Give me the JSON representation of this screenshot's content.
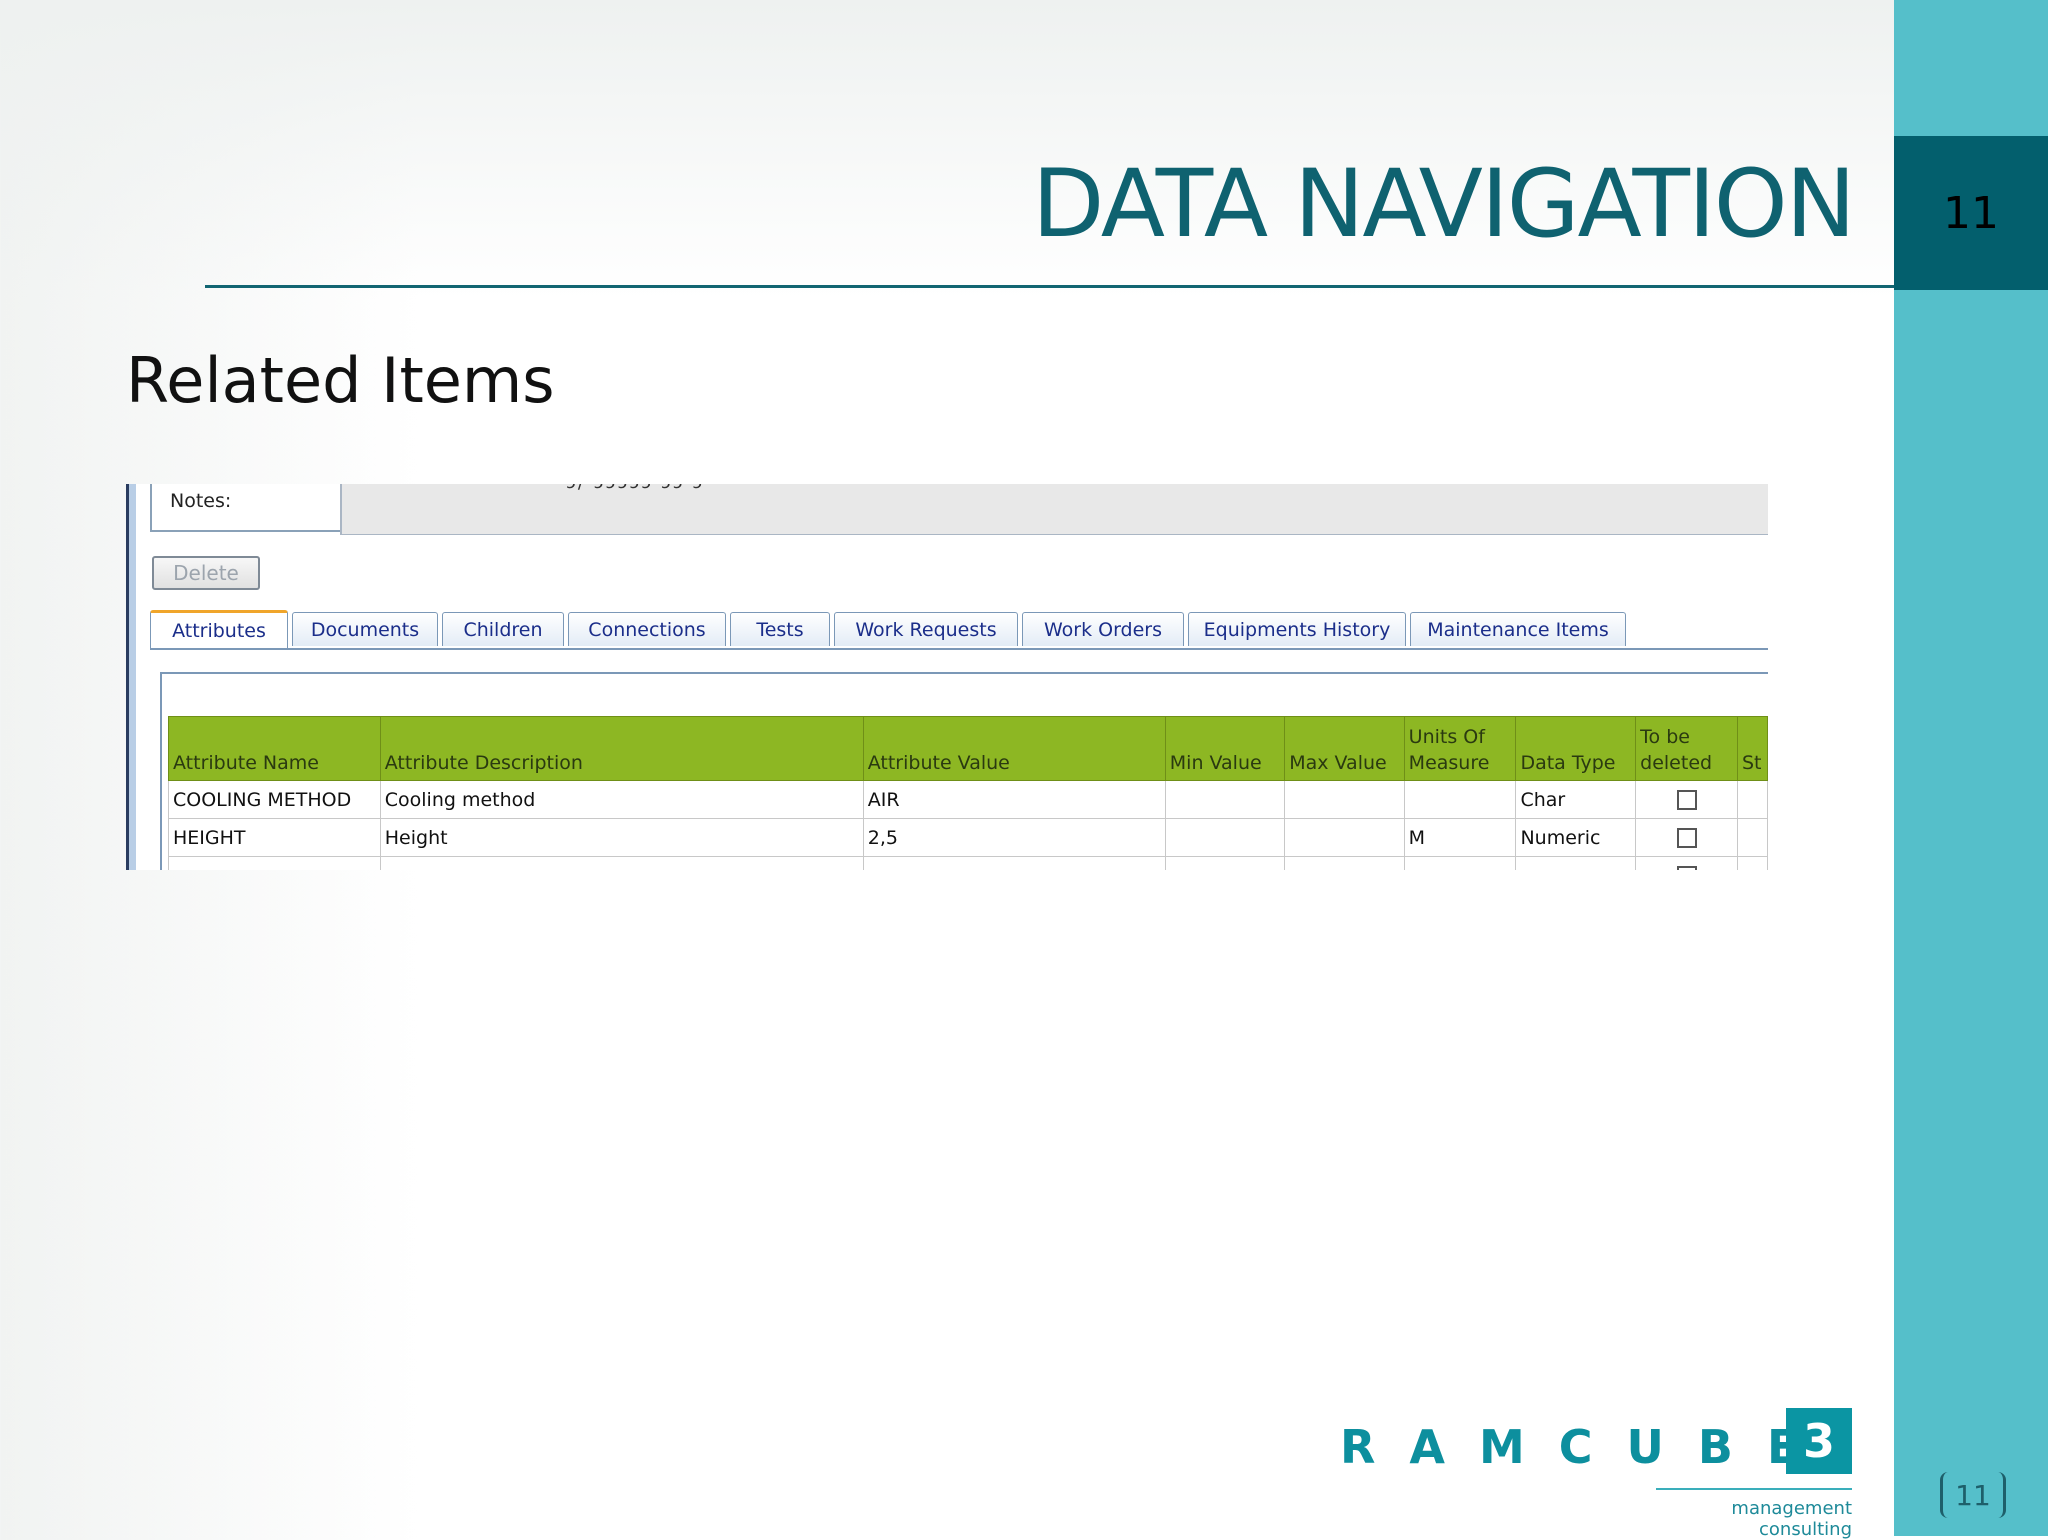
{
  "slide": {
    "title": "DATA NAVIGATION",
    "page_number": "11",
    "subtitle": "Related Items",
    "footer_page": "11"
  },
  "app": {
    "notes_label": "Notes:",
    "notes_cut_text": "ɔ/ ɔɔɔɔɔ ɔɔ ɔ",
    "delete_label": "Delete",
    "tabs": [
      {
        "label": "Attributes"
      },
      {
        "label": "Documents"
      },
      {
        "label": "Children"
      },
      {
        "label": "Connections"
      },
      {
        "label": "Tests"
      },
      {
        "label": "Work Requests"
      },
      {
        "label": "Work Orders"
      },
      {
        "label": "Equipments History"
      },
      {
        "label": "Maintenance Items"
      }
    ],
    "table": {
      "columns": [
        "Attribute Name",
        "Attribute Description",
        "Attribute Value",
        "Min Value",
        "Max Value",
        "Units Of Measure",
        "Data Type",
        "To be deleted",
        "St"
      ],
      "rows": [
        {
          "name": "COOLING METHOD",
          "description": "Cooling method",
          "value": "AIR",
          "min": "",
          "max": "",
          "uom": "",
          "type": "Char"
        },
        {
          "name": "HEIGHT",
          "description": "Height",
          "value": "2,5",
          "min": "",
          "max": "",
          "uom": "M",
          "type": "Numeric"
        },
        {
          "name": "",
          "description": "",
          "value": "",
          "min": "",
          "max": "",
          "uom": "",
          "type": ""
        }
      ]
    }
  },
  "logo": {
    "wordmark": "RAMCUBE",
    "box_char": "3",
    "tagline": "management consulting"
  },
  "colors": {
    "accent_teal": "#0f6270",
    "side_bar": "#55bfca",
    "page_box": "#035f6d",
    "table_header": "#8db723"
  }
}
